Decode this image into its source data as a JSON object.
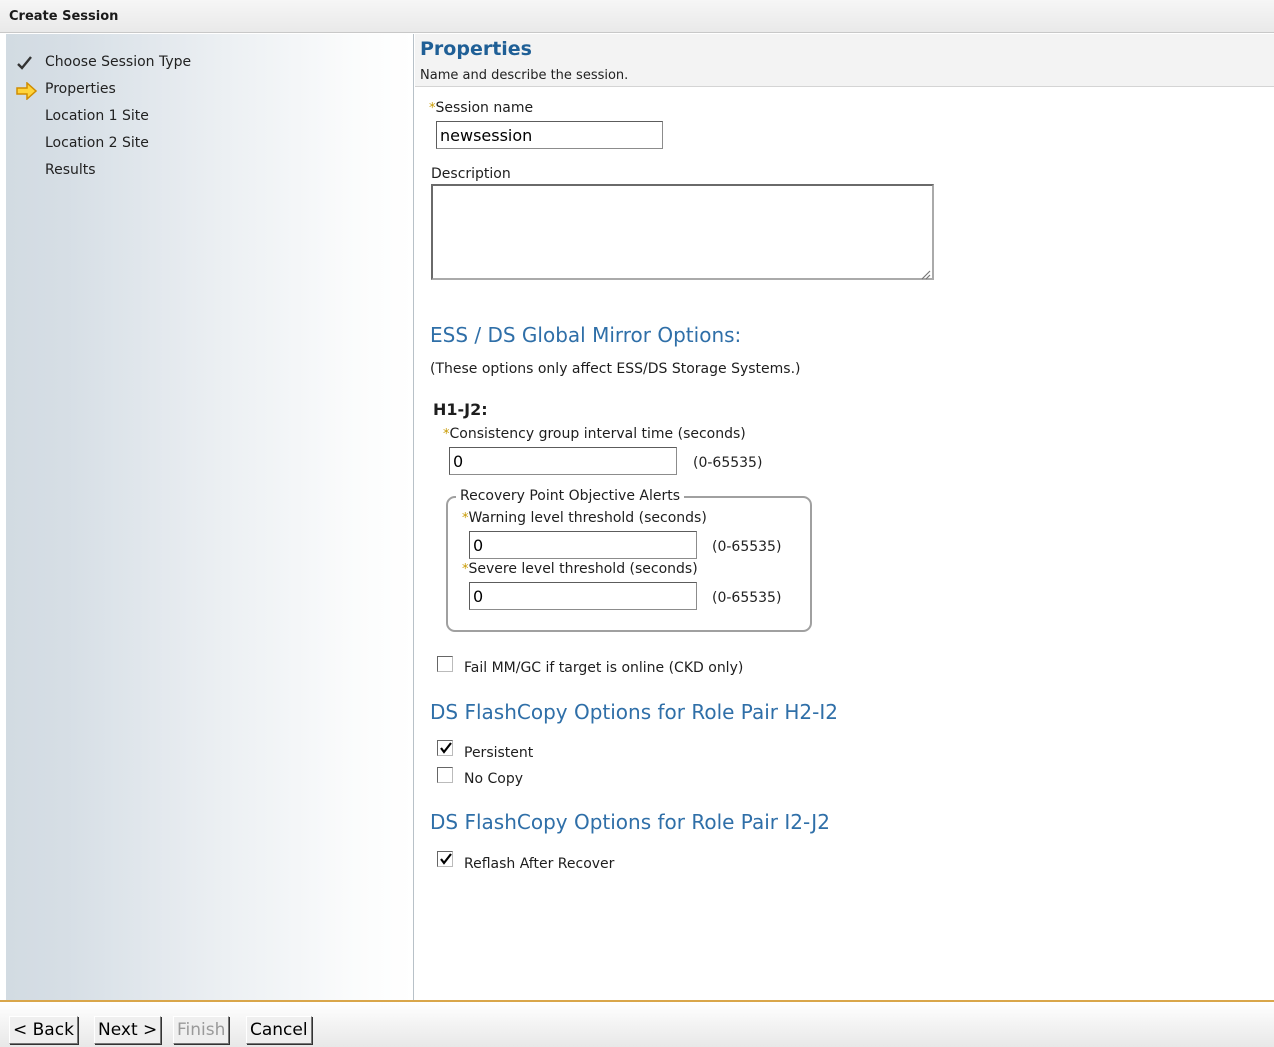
{
  "window": {
    "title": "Create Session"
  },
  "steps": [
    {
      "label": "Choose Session Type",
      "state": "done",
      "icon": "checkmark-icon"
    },
    {
      "label": "Properties",
      "state": "current",
      "icon": "arrow-right-icon"
    },
    {
      "label": "Location 1 Site",
      "state": "pending"
    },
    {
      "label": "Location 2 Site",
      "state": "pending"
    },
    {
      "label": "Results",
      "state": "pending"
    }
  ],
  "header": {
    "title": "Properties",
    "subtitle": "Name and describe the session."
  },
  "form": {
    "session_name_label": "Session name",
    "session_name_value": "newsession",
    "description_label": "Description",
    "description_value": "",
    "required_mark": "*"
  },
  "ess": {
    "heading": "ESS / DS Global Mirror Options:",
    "note": "(These options only affect ESS/DS Storage Systems.)",
    "pair_label": "H1-J2:",
    "consistency_label": "Consistency group interval time (seconds)",
    "consistency_value": "0",
    "consistency_range": "(0-65535)",
    "rpo_legend": "Recovery Point Objective Alerts",
    "warning_label": "Warning level threshold (seconds)",
    "warning_value": "0",
    "warning_range": "(0-65535)",
    "severe_label": "Severe level threshold (seconds)",
    "severe_value": "0",
    "severe_range": "(0-65535)",
    "fail_label": "Fail MM/GC if target is online (CKD only)",
    "fail_checked": false
  },
  "flash_h2i2": {
    "heading": "DS FlashCopy Options for Role Pair H2-I2",
    "persistent_label": "Persistent",
    "persistent_checked": true,
    "nocopy_label": "No Copy",
    "nocopy_checked": false
  },
  "flash_i2j2": {
    "heading": "DS FlashCopy Options for Role Pair I2-J2",
    "reflash_label": "Reflash After Recover",
    "reflash_checked": true
  },
  "footer": {
    "back_label": "< Back",
    "next_label": "Next >",
    "finish_label": "Finish",
    "cancel_label": "Cancel"
  },
  "colors": {
    "accent": "#2f6fa8",
    "title_blue": "#1f5f96",
    "required": "#c89a00",
    "current_arrow": "#f0b400",
    "footer_rule": "#d9a64a"
  }
}
